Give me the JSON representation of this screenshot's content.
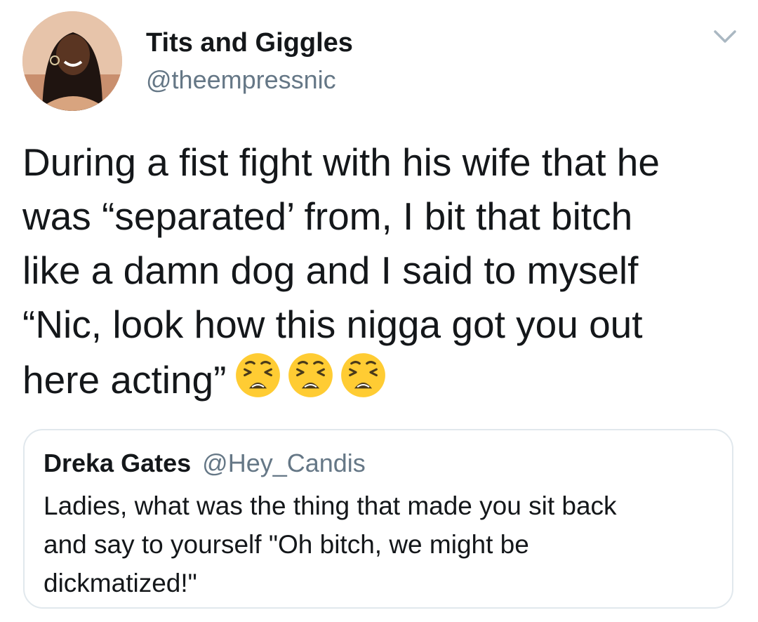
{
  "author": {
    "display_name": "Tits and Giggles",
    "handle": "@theempressnic",
    "avatar_icon": "profile-photo"
  },
  "menu": {
    "icon": "chevron-down-icon",
    "color": "#aab8c2"
  },
  "tweet": {
    "lines": [
      "During a fist fight with his wife that he",
      "was “separated’ from, I bit that bitch",
      "like a damn dog and I said to myself",
      "“Nic, look how this nigga got you out",
      "here acting”"
    ],
    "emoji": [
      "weary-face-emoji",
      "weary-face-emoji",
      "weary-face-emoji"
    ]
  },
  "quoted_tweet": {
    "display_name": "Dreka Gates",
    "handle": "@Hey_Candis",
    "lines": [
      "Ladies, what was the thing that made you sit back",
      "and say to yourself \"Oh bitch, we might be",
      "dickmatized!\""
    ]
  },
  "colors": {
    "text": "#14171a",
    "secondary": "#657786",
    "border": "#e1e8ed",
    "emoji_yellow": "#ffcc33"
  }
}
